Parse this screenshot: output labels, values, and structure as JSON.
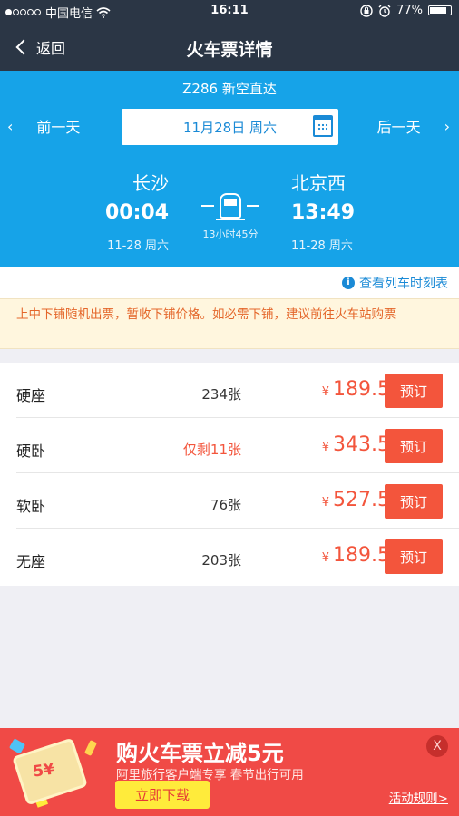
{
  "status_bar": {
    "signal_dots": 5,
    "signal_on": 1,
    "carrier": "中国电信",
    "wifi_icon": "wifi-icon",
    "time": "16:11",
    "lock_rotation_icon": "lock-rotation-icon",
    "alarm_icon": "alarm-icon",
    "battery_percent": "77%",
    "battery_level": 0.77
  },
  "nav": {
    "back_label": "返回",
    "title": "火车票详情"
  },
  "hero": {
    "train_name": "Z286 新空直达",
    "prev_label": "前一天",
    "next_label": "后一天",
    "date_label": "11月28日 周六",
    "departure": {
      "city": "长沙",
      "time": "00:04",
      "date": "11-28 周六"
    },
    "arrival": {
      "city": "北京西",
      "time": "13:49",
      "date": "11-28 周六"
    },
    "duration": "13小时45分"
  },
  "timetable_link": "查看列车时刻表",
  "notice": "上中下铺随机出票，暂收下铺价格。如必需下铺，建议前往火车站购票",
  "seats": [
    {
      "name": "硬座",
      "count": "234张",
      "low": false,
      "currency": "¥",
      "price": "189.5",
      "button": "预订"
    },
    {
      "name": "硬卧",
      "count": "仅剩11张",
      "low": true,
      "currency": "¥",
      "price": "343.5",
      "button": "预订"
    },
    {
      "name": "软卧",
      "count": "76张",
      "low": false,
      "currency": "¥",
      "price": "527.5",
      "button": "预订"
    },
    {
      "name": "无座",
      "count": "203张",
      "low": false,
      "currency": "¥",
      "price": "189.5",
      "button": "预订"
    }
  ],
  "promo": {
    "ticket_text": "5¥",
    "title": "购火车票立减5元",
    "subtitle": "阿里旅行客户端专享 春节出行可用",
    "download_label": "立即下载",
    "rules_label": "活动规则>",
    "close_label": "X"
  },
  "colors": {
    "nav_bg": "#2b3645",
    "hero_bg": "#16a3e8",
    "accent_red": "#f3553c",
    "link_blue": "#1a8ad6",
    "notice_bg": "#fff6de",
    "notice_text": "#e4662a",
    "promo_bg": "#f04a46",
    "promo_button": "#ffeb3b"
  }
}
